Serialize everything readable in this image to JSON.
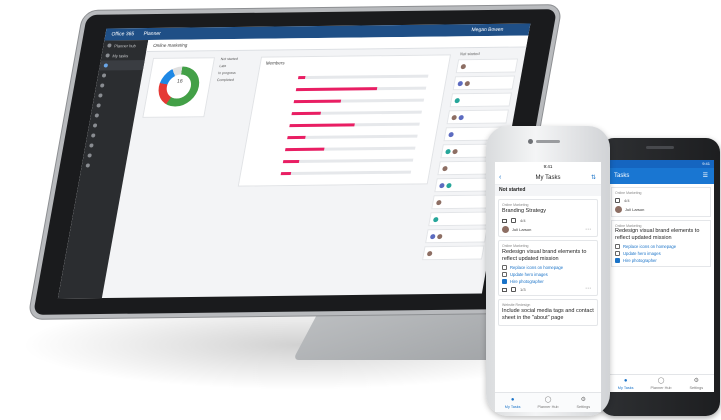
{
  "tablet": {
    "window_title": "Office 365",
    "app_name": "Planner",
    "user_name": "Megan Bowen",
    "board_name": "Online marketing",
    "sidebar_items": [
      "Planner hub",
      "My tasks",
      "",
      "",
      "",
      "",
      "",
      "",
      "",
      "",
      "",
      "",
      ""
    ],
    "chart_center_label": "16",
    "status_labels": [
      "Not started",
      "Late",
      "In progress",
      "Completed"
    ],
    "bars_title": "Members",
    "bar_rows": [
      {
        "name": "",
        "value": 0.05
      },
      {
        "name": "",
        "value": 0.62
      },
      {
        "name": "",
        "value": 0.36
      },
      {
        "name": "",
        "value": 0.22
      },
      {
        "name": "",
        "value": 0.5
      },
      {
        "name": "",
        "value": 0.14
      },
      {
        "name": "",
        "value": 0.3
      },
      {
        "name": "",
        "value": 0.12
      },
      {
        "name": "",
        "value": 0.08
      }
    ],
    "bucket_title": "Not started"
  },
  "iphone": {
    "time": "9:41",
    "nav_title": "My Tasks",
    "section": "Not started",
    "tasks": [
      {
        "plan": "Online Marketing",
        "title": "Branding Strategy",
        "progress": "4/4",
        "assignee": "Juli Larson"
      },
      {
        "plan": "Online Marketing",
        "title": "Redesign visual brand elements to reflect updated mission",
        "checklist": [
          {
            "label": "Replace icons on homepage",
            "checked": false
          },
          {
            "label": "Update hero images",
            "checked": false
          },
          {
            "label": "Hire photographer",
            "checked": true
          }
        ],
        "progress": "1/3"
      },
      {
        "plan": "Website Redesign",
        "title": "Include social media tags and contact sheet in the \"about\" page"
      }
    ],
    "tabs": [
      "My Tasks",
      "Planner Hub",
      "Settings"
    ]
  },
  "android": {
    "time": "9:41",
    "app_title": "Tasks",
    "tasks": [
      {
        "plan": "Online Marketing",
        "title": "",
        "progress": "4/4",
        "assignee": "Juli Larson"
      },
      {
        "plan": "Online Marketing",
        "title": "Redesign visual brand elements to reflect updated mission",
        "checklist": [
          {
            "label": "Replace icons on homepage",
            "checked": false
          },
          {
            "label": "Update hero images",
            "checked": false
          },
          {
            "label": "Hire photographer",
            "checked": true
          }
        ]
      }
    ],
    "tabs": [
      "My Tasks",
      "Planner Hub",
      "Settings"
    ]
  }
}
